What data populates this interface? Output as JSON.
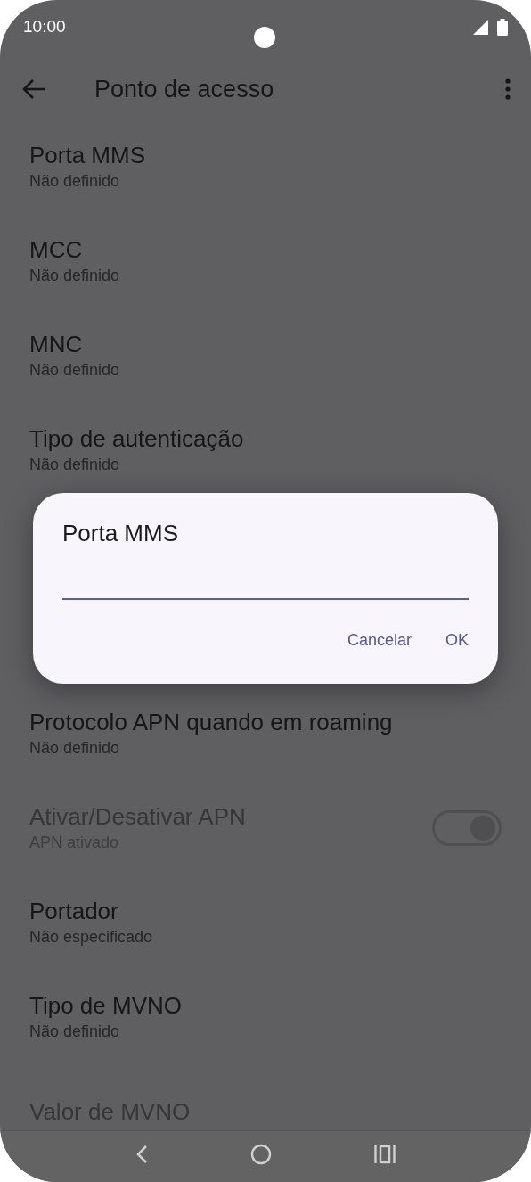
{
  "status_bar": {
    "time": "10:00"
  },
  "app_bar": {
    "title": "Ponto de acesso"
  },
  "settings": [
    {
      "kind": "text",
      "title": "Porta MMS",
      "value": "Não definido",
      "disabled": false
    },
    {
      "kind": "text",
      "title": "MCC",
      "value": "Não definido",
      "disabled": false
    },
    {
      "kind": "text",
      "title": "MNC",
      "value": "Não definido",
      "disabled": false
    },
    {
      "kind": "text",
      "title": "Tipo de autenticação",
      "value": "Não definido",
      "disabled": false
    },
    {
      "kind": "covered"
    },
    {
      "kind": "covered"
    },
    {
      "kind": "text",
      "title": "Protocolo APN quando em roaming",
      "value": "Não definido",
      "disabled": false
    },
    {
      "kind": "switch",
      "title": "Ativar/Desativar APN",
      "value": "APN ativado",
      "disabled": true,
      "on": true
    },
    {
      "kind": "text",
      "title": "Portador",
      "value": "Não especificado",
      "disabled": false
    },
    {
      "kind": "text",
      "title": "Tipo de MVNO",
      "value": "Não definido",
      "disabled": false
    },
    {
      "kind": "text",
      "title": "Valor de MVNO",
      "disabled": true
    }
  ],
  "dialog": {
    "title": "Porta MMS",
    "buttons": [
      "Cancelar",
      "OK"
    ]
  }
}
